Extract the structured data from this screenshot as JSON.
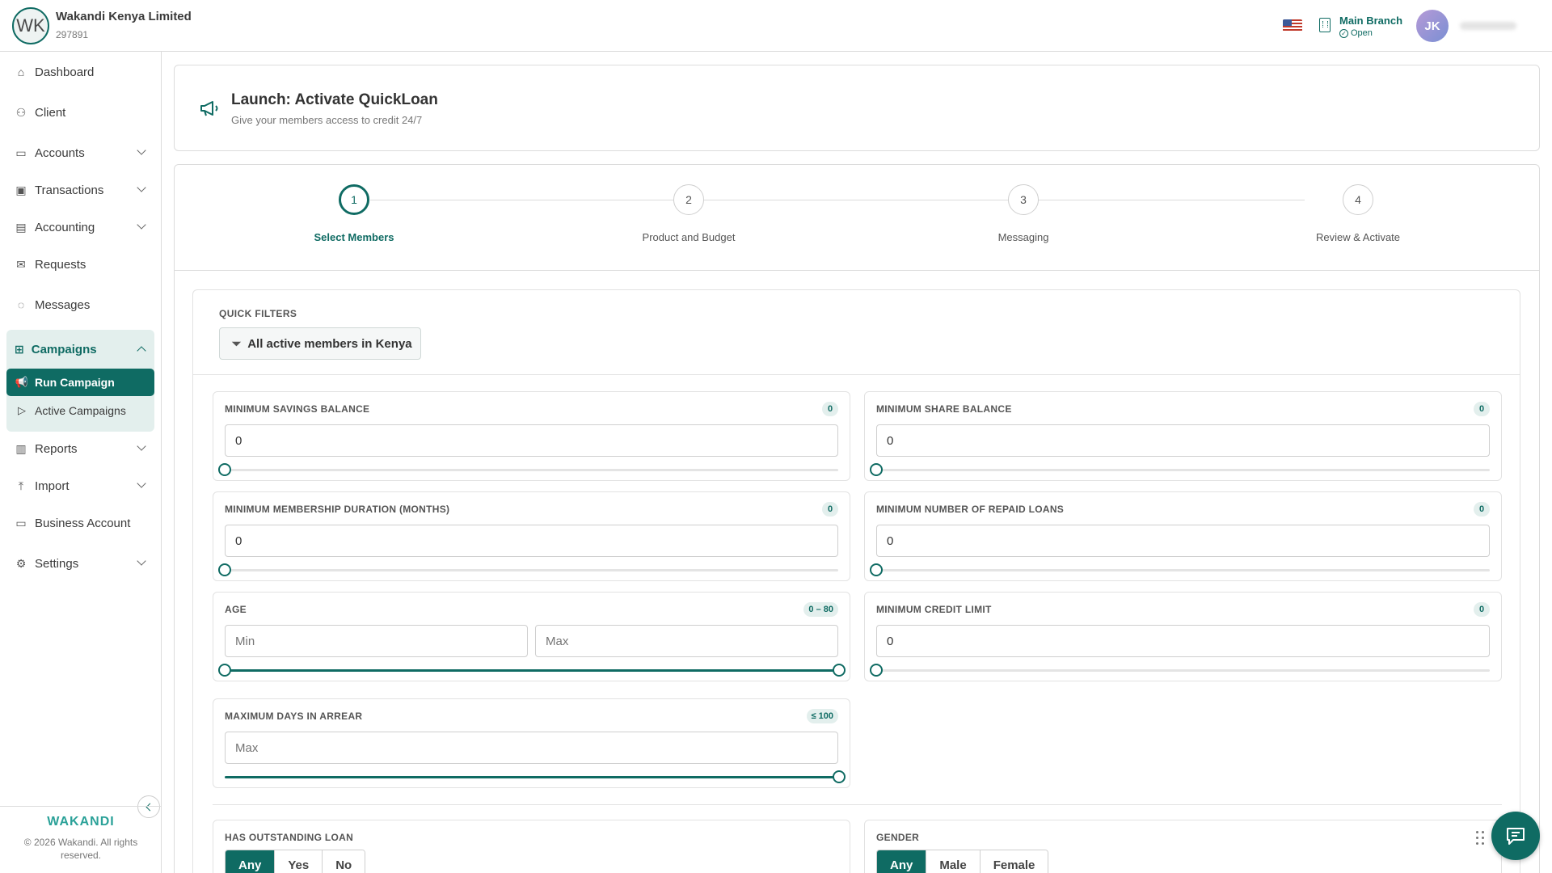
{
  "header": {
    "logo_initials": "WK",
    "org_name": "Wakandi Kenya Limited",
    "org_id": "297891",
    "branch_name": "Main Branch",
    "branch_status": "Open",
    "avatar_initials": "JK"
  },
  "sidebar": {
    "items": [
      {
        "label": "Dashboard",
        "icon": "home-icon"
      },
      {
        "label": "Client",
        "icon": "users-icon"
      },
      {
        "label": "Accounts",
        "icon": "wallet-icon"
      },
      {
        "label": "Transactions",
        "icon": "cash-icon"
      },
      {
        "label": "Accounting",
        "icon": "ledger-icon"
      },
      {
        "label": "Requests",
        "icon": "mail-icon"
      },
      {
        "label": "Messages",
        "icon": "chat-icon"
      },
      {
        "label": "Campaigns",
        "icon": "grid-icon"
      },
      {
        "label": "Reports",
        "icon": "bar-chart-icon"
      },
      {
        "label": "Import",
        "icon": "upload-icon"
      },
      {
        "label": "Business Account",
        "icon": "briefcase-icon"
      },
      {
        "label": "Settings",
        "icon": "gear-icon"
      }
    ],
    "campaign_sub": [
      {
        "label": "Run Campaign",
        "icon": "megaphone-icon"
      },
      {
        "label": "Active Campaigns",
        "icon": "play-icon"
      }
    ],
    "brand": "WAKANDI",
    "copyright": "© 2026 Wakandi. All rights reserved."
  },
  "page": {
    "title": "Launch: Activate QuickLoan",
    "subtitle": "Give your members access to credit 24/7"
  },
  "steps": [
    {
      "number": "1",
      "label": "Select Members"
    },
    {
      "number": "2",
      "label": "Product and Budget"
    },
    {
      "number": "3",
      "label": "Messaging"
    },
    {
      "number": "4",
      "label": "Review & Activate"
    }
  ],
  "filters": {
    "quick_filters_label": "QUICK FILTERS",
    "quick_filter_chip": "All active members in Kenya",
    "min_savings": {
      "label": "MINIMUM SAVINGS BALANCE",
      "badge": "0",
      "value": "0"
    },
    "min_share": {
      "label": "MINIMUM SHARE BALANCE",
      "badge": "0",
      "value": "0"
    },
    "min_membership": {
      "label": "MINIMUM MEMBERSHIP DURATION (MONTHS)",
      "badge": "0",
      "value": "0"
    },
    "min_repaid": {
      "label": "MINIMUM NUMBER OF REPAID LOANS",
      "badge": "0",
      "value": "0"
    },
    "age": {
      "label": "AGE",
      "badge": "0 – 80",
      "min_placeholder": "Min",
      "max_placeholder": "Max",
      "range": [
        0,
        80
      ]
    },
    "min_credit": {
      "label": "MINIMUM CREDIT LIMIT",
      "badge": "0",
      "value": "0"
    },
    "max_arrear": {
      "label": "MAXIMUM DAYS IN ARREAR",
      "badge": "≤ 100",
      "max_placeholder": "Max",
      "value": 100
    },
    "outstanding_loan": {
      "label": "HAS OUTSTANDING LOAN",
      "options": [
        "Any",
        "Yes",
        "No"
      ],
      "selected": "Any"
    },
    "gender": {
      "label": "GENDER",
      "options": [
        "Any",
        "Male",
        "Female"
      ],
      "selected": "Any"
    }
  },
  "colors": {
    "accent": "#0f6b63",
    "accent_light": "#e3efed",
    "border": "#dcdcdc"
  }
}
